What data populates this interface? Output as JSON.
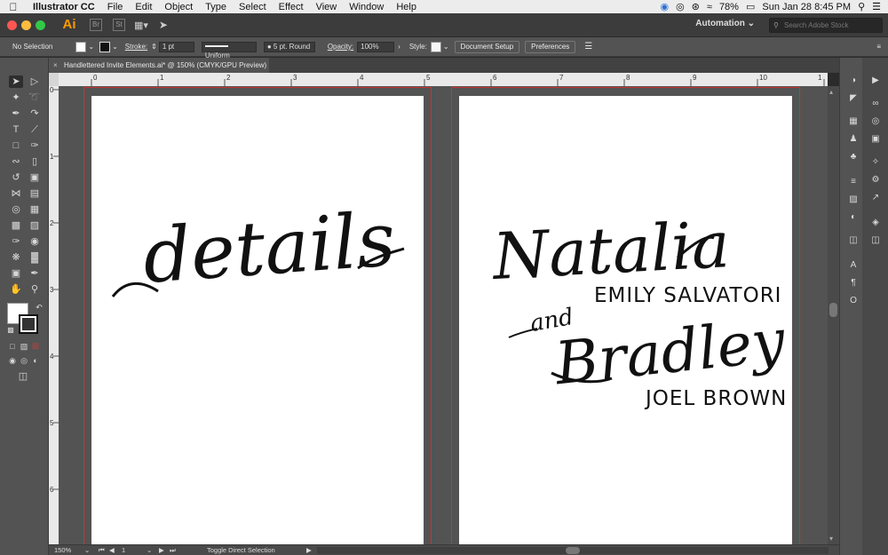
{
  "menubar": {
    "app_name": "Illustrator CC",
    "items": [
      "File",
      "Edit",
      "Object",
      "Type",
      "Select",
      "Effect",
      "View",
      "Window",
      "Help"
    ],
    "battery": "78%",
    "clock": "Sun Jan 28  8:45 PM"
  },
  "appbar": {
    "logo": "Ai",
    "app_icon_br": "Br",
    "app_icon_st": "St",
    "workspace": "Automation",
    "search_placeholder": "Search Adobe Stock"
  },
  "controlbar": {
    "selection": "No Selection",
    "stroke_label": "Stroke:",
    "stroke_weight": "1 pt",
    "profile": "Uniform",
    "brush": "5 pt. Round",
    "opacity_label": "Opacity:",
    "opacity": "100%",
    "style_label": "Style:",
    "document_setup": "Document Setup",
    "preferences": "Preferences"
  },
  "document": {
    "tab_title": "Handlettered Invite Elements.ai* @ 150% (CMYK/GPU Preview)"
  },
  "rulers": {
    "h_ticks": [
      "0",
      "1",
      "2",
      "3",
      "4",
      "5",
      "6",
      "7",
      "8",
      "9",
      "10",
      "1"
    ],
    "v_ticks": [
      "0",
      "1",
      "2",
      "3",
      "4",
      "5",
      "6"
    ]
  },
  "artwork": {
    "details": "details",
    "natalia": "Natalia",
    "emily": "EMILY SALVATORI",
    "and": "and",
    "bradley": "Bradley",
    "joel": "JOEL BROWN"
  },
  "status": {
    "zoom": "150%",
    "artboard_number": "1",
    "tool_hint": "Toggle Direct Selection"
  }
}
